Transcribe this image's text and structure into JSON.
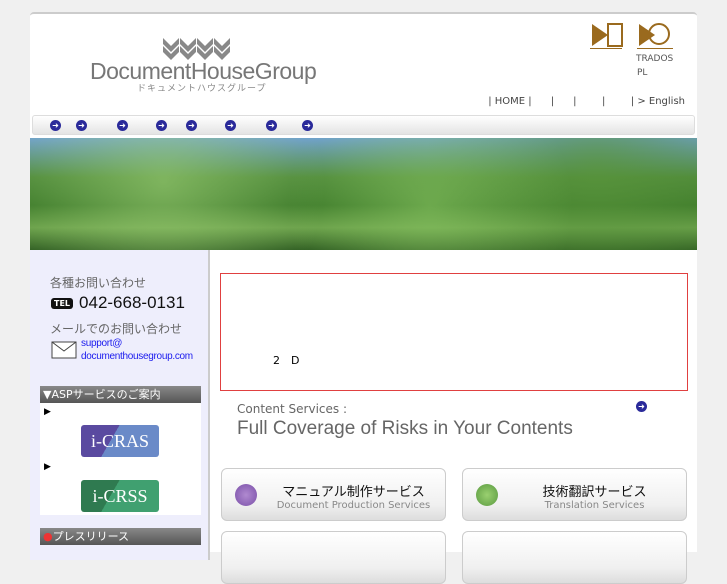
{
  "header": {
    "logo_text": "DocumentHouseGroup",
    "logo_sub": "ドキュメントハウスグループ",
    "brand_trados": "TRADOS",
    "brand_pl": "PL",
    "top_links": "| HOME |      |      |        |        | > English"
  },
  "nav": {
    "arrow_count": 8
  },
  "sidebar": {
    "contact_label": "各種お問い合わせ",
    "tel_badge": "TEL",
    "tel": "042-668-0131",
    "mail_label": "メールでのお問い合わせ",
    "email_line1": "support@",
    "email_line2": "documenthousegroup.com",
    "asp_heading": "ASPサービスのご案内",
    "icras": "i-CRAS",
    "icriss": "i-CRSS",
    "press_heading": "プレスリリース"
  },
  "main": {
    "notice": "2　D",
    "services_kicker": "Content Services :",
    "services_title": "Full Coverage of Risks in Your Contents",
    "services": [
      {
        "jp": "マニュアル制作サービス",
        "en": "Document Production Services",
        "color": "#7a4fa8"
      },
      {
        "jp": "技術翻訳サービス",
        "en": "Translation Services",
        "color": "#5a9a40"
      }
    ]
  }
}
